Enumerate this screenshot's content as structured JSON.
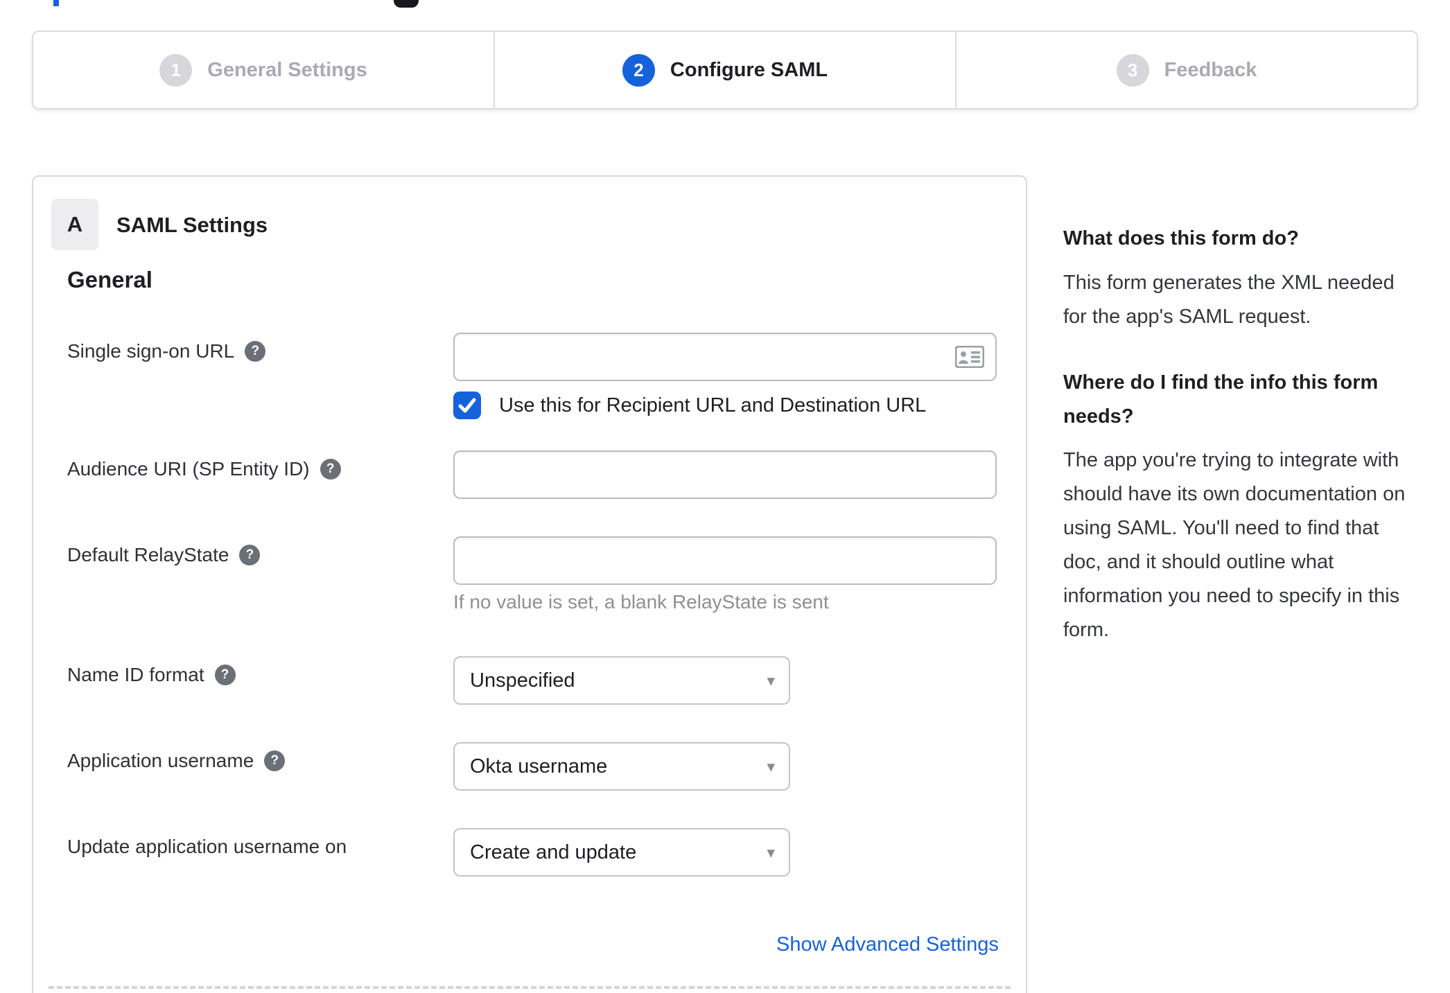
{
  "colors": {
    "accent_blue": "#1662dd",
    "inactive_gray": "#d6d6db",
    "border_gray": "#d9d9de",
    "helper_gray": "#8d9095"
  },
  "icons": {
    "help": "?",
    "caret_down": "▾"
  },
  "stepper": {
    "steps": [
      {
        "number": "1",
        "label": "General Settings",
        "active": false
      },
      {
        "number": "2",
        "label": "Configure SAML",
        "active": true
      },
      {
        "number": "3",
        "label": "Feedback",
        "active": false
      }
    ]
  },
  "panel": {
    "badge": "A",
    "title": "SAML Settings",
    "section_title": "General",
    "fields": {
      "sso": {
        "label": "Single sign-on URL",
        "value": "",
        "checkbox_label": "Use this for Recipient URL and Destination URL",
        "checked": "true"
      },
      "audience": {
        "label": "Audience URI (SP Entity ID)",
        "value": ""
      },
      "relay": {
        "label": "Default RelayState",
        "value": "",
        "help_text": "If no value is set, a blank RelayState is sent"
      },
      "name_id": {
        "label": "Name ID format",
        "value": "Unspecified"
      },
      "app_username": {
        "label": "Application username",
        "value": "Okta username"
      },
      "update_username": {
        "label": "Update application username on",
        "value": "Create and update"
      }
    },
    "advanced_link": "Show Advanced Settings"
  },
  "sidebar": {
    "section1_title": "What does this form do?",
    "section1_body": "This form generates the XML needed for the app's SAML request.",
    "section2_title": "Where do I find the info this form needs?",
    "section2_body": "The app you're trying to integrate with should have its own documentation on using SAML. You'll need to find that doc, and it should outline what information you need to specify in this form."
  }
}
